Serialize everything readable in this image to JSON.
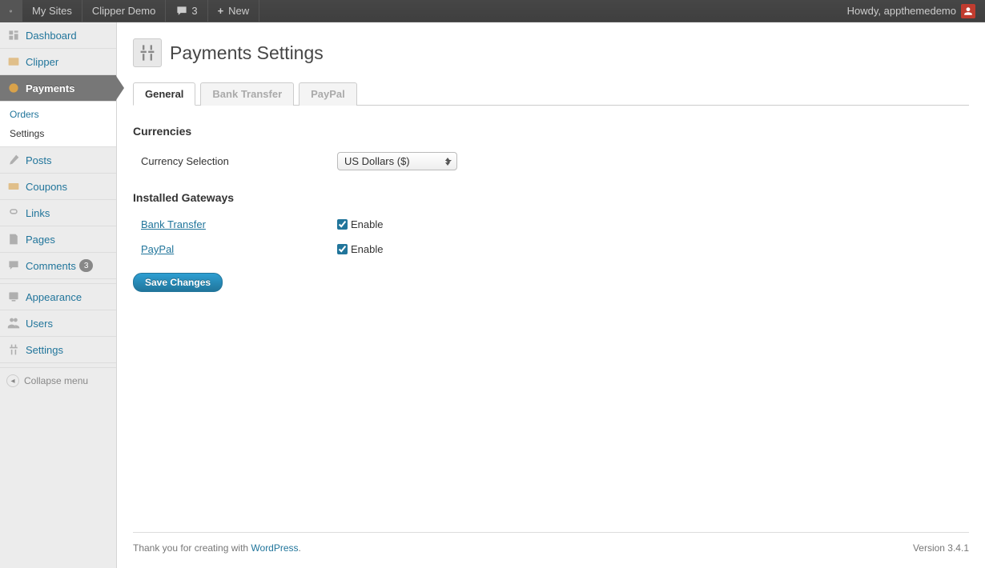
{
  "adminbar": {
    "my_sites": "My Sites",
    "site_name": "Clipper Demo",
    "comments_count": "3",
    "new_label": "New",
    "howdy": "Howdy, appthemedemo"
  },
  "sidebar": {
    "dashboard": "Dashboard",
    "clipper": "Clipper",
    "payments": "Payments",
    "submenu": {
      "orders": "Orders",
      "settings": "Settings"
    },
    "posts": "Posts",
    "coupons": "Coupons",
    "links": "Links",
    "pages": "Pages",
    "comments": "Comments",
    "comments_count": "3",
    "appearance": "Appearance",
    "users": "Users",
    "settings_menu": "Settings",
    "collapse": "Collapse menu"
  },
  "page": {
    "title": "Payments Settings"
  },
  "tabs": {
    "general": "General",
    "bank_transfer": "Bank Transfer",
    "paypal": "PayPal"
  },
  "sections": {
    "currencies": "Currencies",
    "gateways": "Installed Gateways"
  },
  "form": {
    "currency_label": "Currency Selection",
    "currency_value": "US Dollars ($)",
    "bank_transfer": "Bank Transfer",
    "paypal": "PayPal",
    "enable": "Enable",
    "bank_transfer_enabled": true,
    "paypal_enabled": true,
    "save": "Save Changes"
  },
  "footer": {
    "thanks_prefix": "Thank you for creating with ",
    "wp": "WordPress",
    "version": "Version 3.4.1"
  }
}
